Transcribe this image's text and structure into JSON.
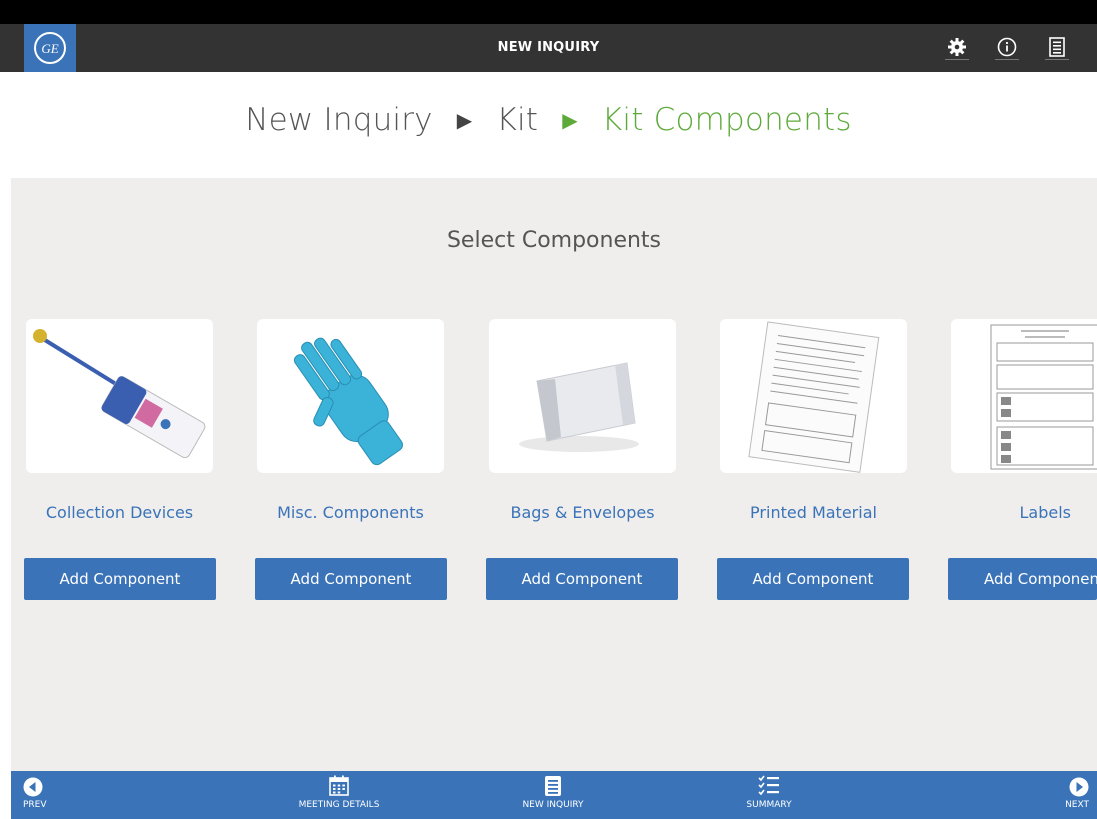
{
  "header": {
    "title": "NEW INQUIRY",
    "logo_text": "GE",
    "icons": [
      "gear-icon",
      "info-icon",
      "list-icon"
    ]
  },
  "breadcrumb": {
    "items": [
      "New Inquiry",
      "Kit",
      "Kit Components"
    ]
  },
  "main": {
    "section_title": "Select Components",
    "cards": [
      {
        "label": "Collection Devices",
        "button": "Add Component",
        "image": "swab-device"
      },
      {
        "label": "Misc. Components",
        "button": "Add Component",
        "image": "blue-glove"
      },
      {
        "label": "Bags & Envelopes",
        "button": "Add Component",
        "image": "foil-bag"
      },
      {
        "label": "Printed Material",
        "button": "Add Component",
        "image": "printed-form"
      },
      {
        "label": "Labels",
        "button": "Add Component",
        "image": "label-sheet"
      }
    ]
  },
  "footer": {
    "prev": "PREV",
    "meeting_details": "MEETING DETAILS",
    "new_inquiry": "NEW INQUIRY",
    "summary": "SUMMARY",
    "next": "NEXT"
  },
  "colors": {
    "accent": "#3a73b8",
    "breadcrumb_active": "#5daa3a",
    "topbar": "#333333",
    "panel": "#efeeed"
  }
}
